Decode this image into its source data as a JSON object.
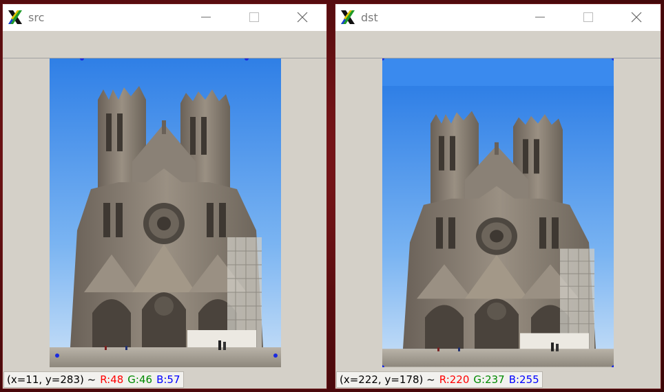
{
  "windows": {
    "src": {
      "title": "src",
      "status": {
        "coords": "(x=11, y=283) ~",
        "r": "R:48",
        "g": "G:46",
        "b": "B:57"
      }
    },
    "dst": {
      "title": "dst",
      "status": {
        "coords": "(x=222, y=178) ~",
        "r": "R:220",
        "g": "G:237",
        "b": "B:255"
      }
    }
  },
  "window_controls": [
    "minimize-icon",
    "maximize-icon",
    "close-icon"
  ],
  "colors": {
    "point_marker": "#1a2ae0",
    "status_r": "#ff0000",
    "status_g": "#008a00",
    "status_b": "#0000ff",
    "window_bg": "#d4d0c8",
    "desktop_bg": "#5a0d10"
  },
  "images": {
    "src": "photo of a gothic cathedral facade under blue sky (perspective-distorted)",
    "dst": "photo of the same cathedral facade after perspective correction"
  }
}
